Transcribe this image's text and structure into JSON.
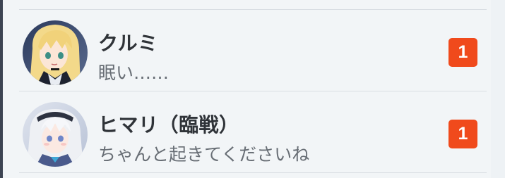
{
  "chats": [
    {
      "name": "クルミ",
      "last_message": "眠い……",
      "unread_count": "1",
      "avatar_icon": "blonde-girl-avatar-icon"
    },
    {
      "name": "ヒマリ（臨戦）",
      "last_message": "ちゃんと起きてくださいね",
      "unread_count": "1",
      "avatar_icon": "silver-hair-girl-avatar-icon"
    }
  ],
  "colors": {
    "background": "#f2f5f7",
    "badge": "#f04a1c",
    "name_text": "#2f3338",
    "message_text": "#686e75",
    "divider": "#d9dee3"
  }
}
